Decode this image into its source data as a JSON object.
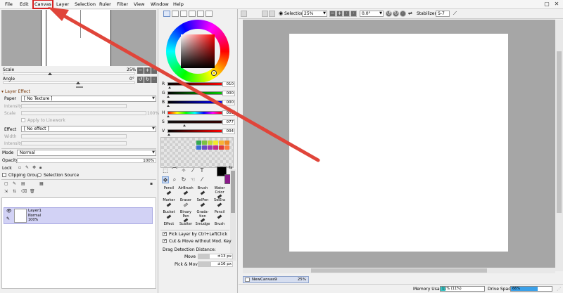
{
  "menu": {
    "items": [
      "File",
      "Edit",
      "Canvas",
      "Layer",
      "Selection",
      "Ruler",
      "Filter",
      "View",
      "Window",
      "Help"
    ],
    "highlighted": "Canvas"
  },
  "navigator": {
    "scale_label": "Scale",
    "scale_value": "25%",
    "angle_label": "Angle",
    "angle_value": "0°"
  },
  "layer_effect": {
    "header": "Layer Effect",
    "paper_label": "Paper",
    "paper_value": "[ No Texture ]",
    "intensity_label": "Intensity",
    "scale_label": "Scale",
    "scale_value": "100%",
    "apply_label": "Apply to Linework",
    "effect_label": "Effect",
    "effect_value": "[ No effect ]",
    "width_label": "Width",
    "intensity2_label": "Intensity"
  },
  "layer_props": {
    "mode_label": "Mode",
    "mode_value": "Normal",
    "opacity_label": "Opacity",
    "opacity_value": "100%",
    "lock_label": "Lock",
    "clipping_label": "Clipping Group",
    "selection_source_label": "Selection Source"
  },
  "layers": [
    {
      "name": "Layer1",
      "mode": "Normal",
      "opacity": "100%"
    }
  ],
  "color": {
    "rows": [
      {
        "label": "R",
        "value": "010"
      },
      {
        "label": "G",
        "value": "000"
      },
      {
        "label": "B",
        "value": "000"
      },
      {
        "label": "H",
        "value": "000"
      },
      {
        "label": "S",
        "value": "077"
      },
      {
        "label": "V",
        "value": "004"
      }
    ],
    "foreground": "#000000",
    "background": "#8b1a8b",
    "swatches": [
      "#34a853",
      "#7cc242",
      "#c6d935",
      "#f2ea2a",
      "#f9b233",
      "#f08a24",
      "#3b6fd8",
      "#6a4bc4",
      "#9b3bb3",
      "#c22c8a",
      "#e03a3a",
      "#ff7a3a"
    ]
  },
  "brushes": {
    "cells": [
      [
        "Pencil",
        "AirBrush",
        "Brush",
        "Water Color"
      ],
      [
        "Marker",
        "Eraser",
        "SelPen",
        "SelEra"
      ],
      [
        "Bucket",
        "Binary Pen",
        "Grada- tion",
        "Pencil"
      ],
      [
        "Effect",
        "Scatter",
        "Smudge",
        "Brush"
      ]
    ]
  },
  "tool_options": {
    "pick_layer": "Pick Layer by Ctrl+LeftClick",
    "cut_move": "Cut & Move without Mod. Key",
    "drag_header": "Drag Detection Distance:",
    "move_label": "Move",
    "move_value": "±13 px",
    "pick_move_label": "Pick & Move",
    "pick_move_value": "±16 px"
  },
  "canvas_toolbar": {
    "selection_label": "Selection",
    "zoom_value": "25%",
    "angle_value": "0.0°",
    "stabilizer_label": "Stabilizer",
    "stabilizer_value": "S-7"
  },
  "document": {
    "tab_name": "NewCanvas9",
    "tab_zoom": "25%"
  },
  "status": {
    "memory_label": "Memory Usage",
    "memory_value": "11% (11%)",
    "memory_fraction": 0.11,
    "drive_label": "Drive Space",
    "drive_value": "66%",
    "drive_fraction": 0.66
  },
  "colors": {
    "annotation_red": "#e0453a",
    "selection_blue": "#d2d2f5",
    "meter_teal": "#36c3c3",
    "meter_blue": "#3aa0e8"
  }
}
